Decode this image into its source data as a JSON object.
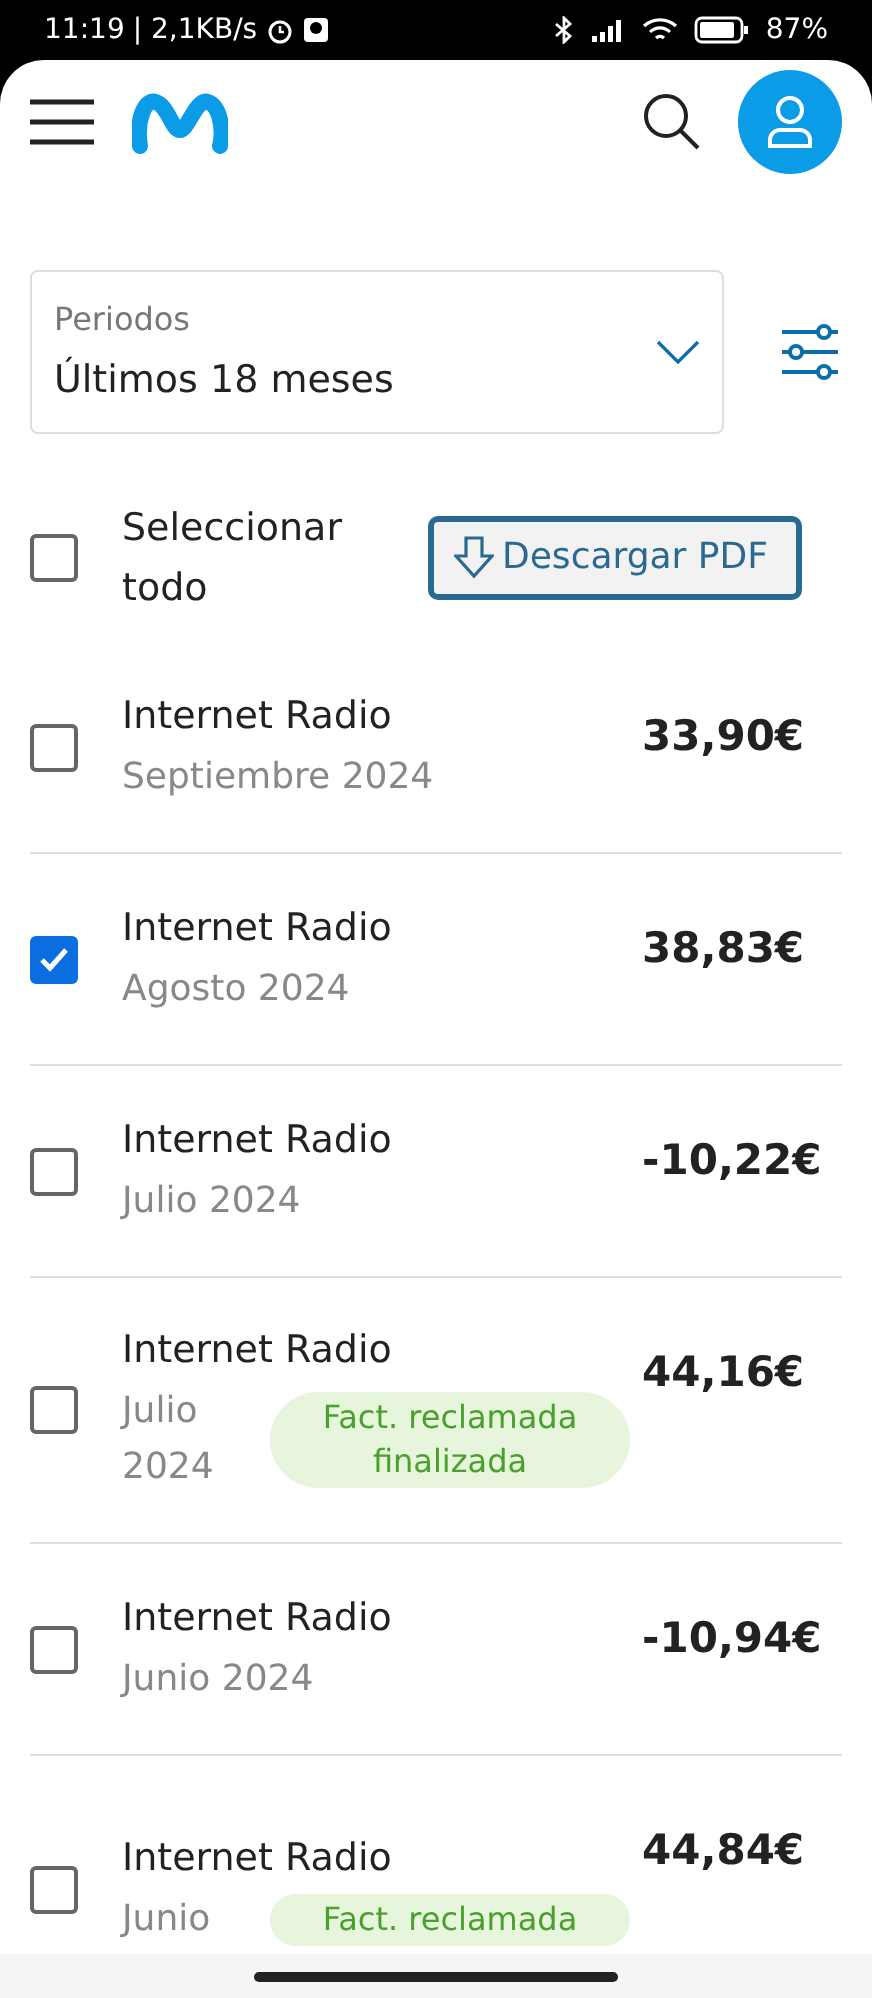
{
  "status_bar": {
    "time": "11:19",
    "speed": "| 2,1KB/s",
    "battery": "87%"
  },
  "periods": {
    "label": "Periodos",
    "value": "Últimos 18 meses"
  },
  "select_all": {
    "label": "Seleccionar todo",
    "checked": false
  },
  "download_button": "Descargar PDF",
  "invoices": [
    {
      "name": "Internet Radio",
      "date": "Septiembre 2024",
      "amount": "33,90€",
      "checked": false
    },
    {
      "name": "Internet Radio",
      "date": "Agosto 2024",
      "amount": "38,83€",
      "checked": true
    },
    {
      "name": "Internet Radio",
      "date": "Julio 2024",
      "amount": "-10,22€",
      "checked": false
    },
    {
      "name": "Internet Radio",
      "date": "Julio 2024",
      "amount": "44,16€",
      "checked": false,
      "badge": "Fact. reclamada finalizada"
    },
    {
      "name": "Internet Radio",
      "date": "Junio 2024",
      "amount": "-10,94€",
      "checked": false
    },
    {
      "name": "Internet Radio",
      "date": "Junio",
      "amount": "44,84€",
      "checked": false,
      "badge": "Fact. reclamada"
    }
  ]
}
